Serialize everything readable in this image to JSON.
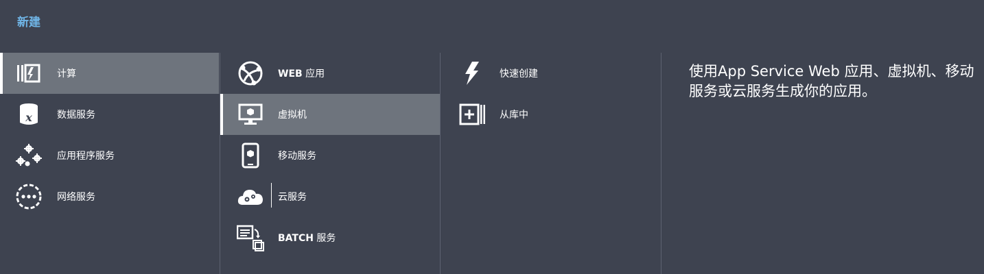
{
  "header": {
    "title": "新建"
  },
  "categories": [
    {
      "label": "计算",
      "icon": "compute-icon"
    },
    {
      "label": "数据服务",
      "icon": "data-services-icon"
    },
    {
      "label": "应用程序服务",
      "icon": "app-services-icon"
    },
    {
      "label": "网络服务",
      "icon": "network-services-icon"
    }
  ],
  "compute_services": [
    {
      "label_bold": "WEB",
      "label_rest": " 应用",
      "icon": "web-app-icon"
    },
    {
      "label_bold": "",
      "label_rest": "虚拟机",
      "icon": "virtual-machine-icon"
    },
    {
      "label_bold": "",
      "label_rest": "移动服务",
      "icon": "mobile-services-icon"
    },
    {
      "label_bold": "",
      "label_rest": "云服务",
      "icon": "cloud-services-icon"
    },
    {
      "label_bold": "BATCH",
      "label_rest": " 服务",
      "icon": "batch-services-icon"
    }
  ],
  "create_options": [
    {
      "label": "快速创建",
      "icon": "lightning-icon"
    },
    {
      "label": "从库中",
      "icon": "gallery-add-icon"
    }
  ],
  "description": "使用App Service Web 应用、虚拟机、移动服务或云服务生成你的应用。",
  "colors": {
    "background": "#3e4350",
    "selected": "#6e747d",
    "title": "#6fb4e5",
    "divider": "#5d6270"
  }
}
